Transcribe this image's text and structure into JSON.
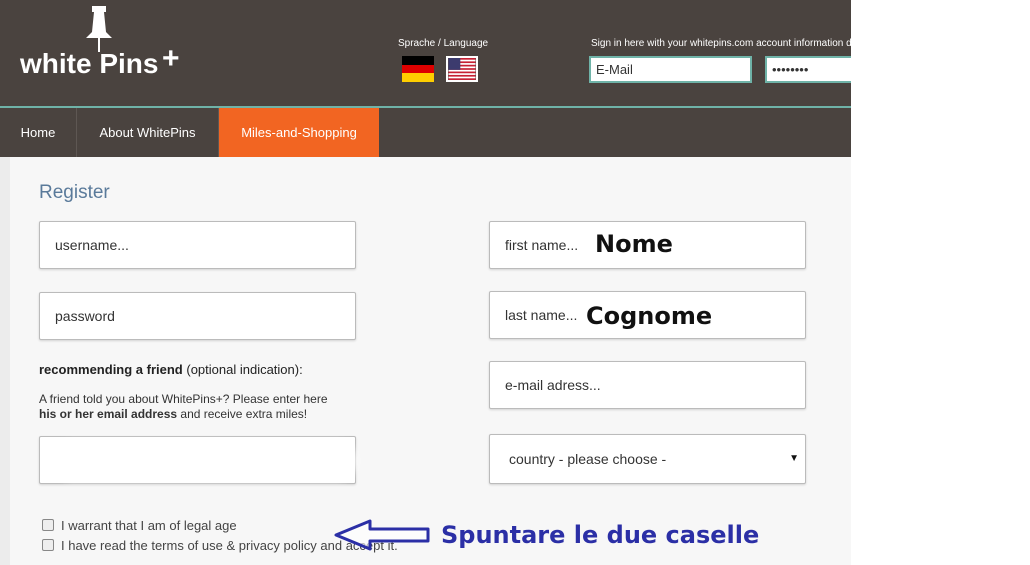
{
  "header": {
    "logo_text": "white Pins",
    "logo_plus": "+",
    "language_label": "Sprache / Language",
    "flags": [
      "de-flag-icon",
      "us-flag-icon"
    ],
    "signin_text": "Sign in here with your whitepins.com account information dire",
    "email_placeholder": "E-Mail",
    "password_value": "••••••••"
  },
  "nav": {
    "items": [
      {
        "label": "Home"
      },
      {
        "label": "About WhitePins"
      },
      {
        "label": "Miles-and-Shopping"
      }
    ],
    "active_color": "#f26522"
  },
  "form": {
    "title": "Register",
    "username_placeholder": "username...",
    "password_placeholder": "password",
    "first_name_placeholder": "first name...",
    "last_name_placeholder": "last name...",
    "email_placeholder": "e-mail adress...",
    "country_placeholder": "country - please choose -",
    "recommend_bold": "recommending a friend",
    "recommend_rest": " (optional indication):",
    "friend_text_1": "A friend told you about WhitePins+? Please enter here",
    "friend_text_bold": "his or her email address",
    "friend_text_2": " and receive extra miles!",
    "checkbox_1": "I warrant that I am of legal age",
    "checkbox_2": "I have read the terms of use & privacy policy and accept it."
  },
  "annotations": {
    "nome": "Nome",
    "cognome": "Cognome",
    "spuntare": "Spuntare le due caselle",
    "color": "#2b2fa6"
  }
}
